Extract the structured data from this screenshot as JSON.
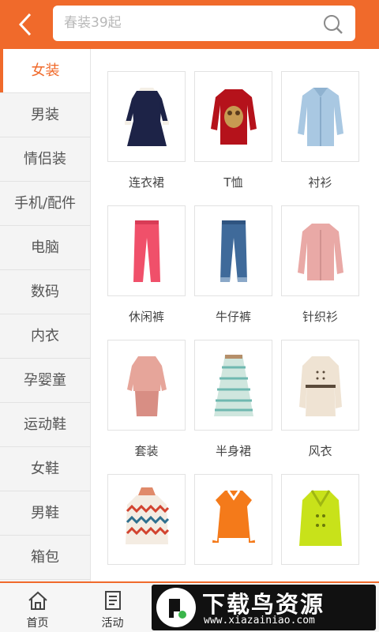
{
  "search": {
    "placeholder": "春装39起"
  },
  "sidebar": {
    "items": [
      {
        "label": "女装",
        "active": true
      },
      {
        "label": "男装"
      },
      {
        "label": "情侣装"
      },
      {
        "label": "手机/配件"
      },
      {
        "label": "电脑"
      },
      {
        "label": "数码"
      },
      {
        "label": "内衣"
      },
      {
        "label": "孕婴童"
      },
      {
        "label": "运动鞋"
      },
      {
        "label": "女鞋"
      },
      {
        "label": "男鞋"
      },
      {
        "label": "箱包"
      }
    ]
  },
  "products": [
    {
      "label": "连衣裙",
      "icon": "dress-icon"
    },
    {
      "label": "T恤",
      "icon": "tshirt-icon"
    },
    {
      "label": "衬衫",
      "icon": "shirt-icon"
    },
    {
      "label": "休闲裤",
      "icon": "casual-pants-icon"
    },
    {
      "label": "牛仔裤",
      "icon": "jeans-icon"
    },
    {
      "label": "针织衫",
      "icon": "cardigan-icon"
    },
    {
      "label": "套装",
      "icon": "suit-icon"
    },
    {
      "label": "半身裙",
      "icon": "skirt-icon"
    },
    {
      "label": "风衣",
      "icon": "trench-coat-icon"
    },
    {
      "label": "",
      "icon": "zigzag-jacket-icon"
    },
    {
      "label": "",
      "icon": "varsity-jacket-icon"
    },
    {
      "label": "",
      "icon": "lime-coat-icon"
    }
  ],
  "tabs": [
    {
      "label": "首页",
      "icon": "home-icon"
    },
    {
      "label": "活动",
      "icon": "receipt-icon"
    }
  ],
  "watermark": {
    "title": "下载鸟资源",
    "url": "www.xiazainiao.com"
  },
  "colors": {
    "accent": "#f06a2b"
  }
}
